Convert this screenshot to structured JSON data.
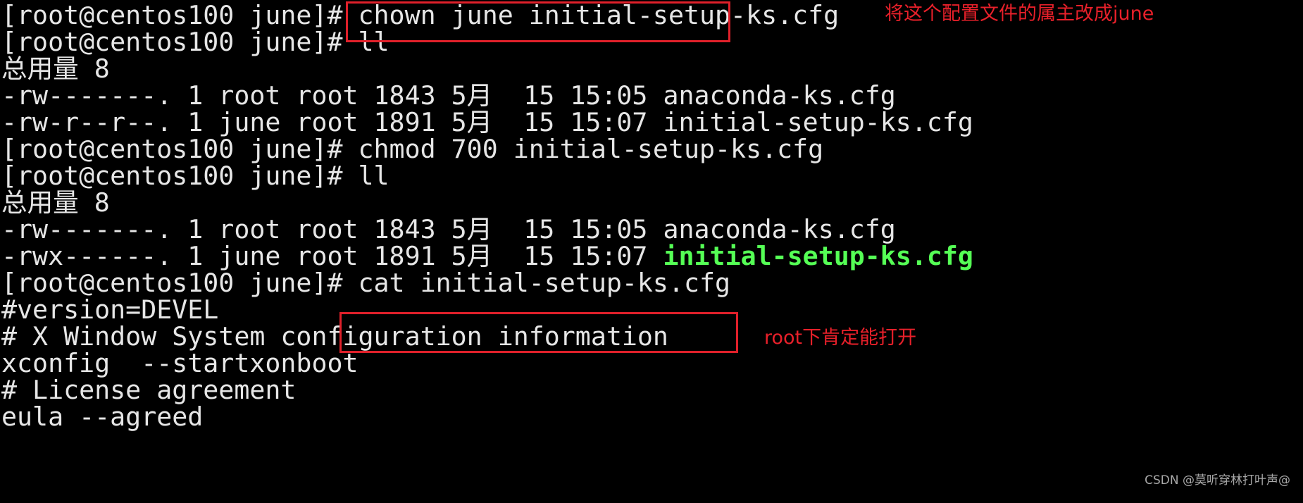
{
  "terminal": {
    "lines": [
      {
        "prompt": "[root@centos100 june]# ",
        "command": "chown june initial-setup-ks.cfg"
      },
      {
        "prompt": "[root@centos100 june]# ",
        "command": "ll"
      },
      {
        "text": "总用量 8"
      },
      {
        "text": "-rw-------. 1 root root 1843 5月  15 15:05 anaconda-ks.cfg"
      },
      {
        "text": "-rw-r--r--. 1 june root 1891 5月  15 15:07 initial-setup-ks.cfg"
      },
      {
        "prompt": "[root@centos100 june]# ",
        "command": "chmod 700 initial-setup-ks.cfg"
      },
      {
        "prompt": "[root@centos100 june]# ",
        "command": "ll"
      },
      {
        "text": "总用量 8"
      },
      {
        "text": "-rw-------. 1 root root 1843 5月  15 15:05 anaconda-ks.cfg"
      },
      {
        "text": "-rwx------. 1 june root 1891 5月  15 15:07 ",
        "executable_file": "initial-setup-ks.cfg"
      },
      {
        "prompt": "[root@centos100 june]# ",
        "command": "cat initial-setup-ks.cfg"
      },
      {
        "text": "#version=DEVEL"
      },
      {
        "text": "# X Window System configuration information"
      },
      {
        "text": "xconfig  --startxonboot"
      },
      {
        "text": "# License agreement"
      },
      {
        "text": "eula --agreed"
      }
    ],
    "colors": {
      "background": "#000000",
      "foreground": "#e6e6e6",
      "executable": "#55ff55"
    }
  },
  "annotations": {
    "chown_note": "将这个配置文件的属主改成june",
    "cat_note": "root下肯定能打开",
    "color": "#e0202a"
  },
  "watermark": "CSDN @莫听穿林打叶声@"
}
